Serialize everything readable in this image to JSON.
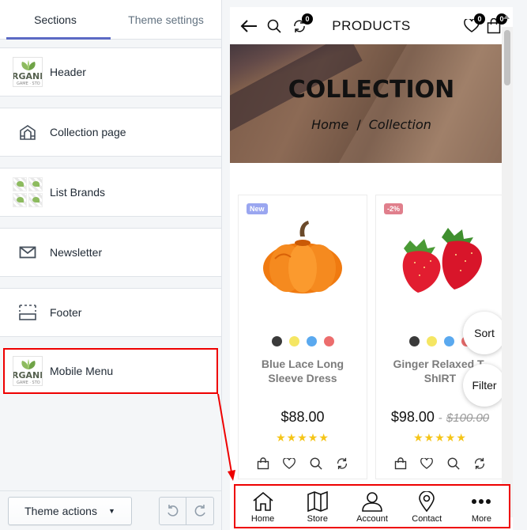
{
  "editor": {
    "tabs": [
      {
        "label": "Sections",
        "active": true
      },
      {
        "label": "Theme settings",
        "active": false
      }
    ],
    "sections": [
      {
        "label": "Header",
        "icon": "logo-thumbnail-icon"
      },
      {
        "label": "Collection page",
        "icon": "collection-page-icon"
      },
      {
        "label": "List Brands",
        "icon": "brand-grid-icon"
      },
      {
        "label": "Newsletter",
        "icon": "envelope-icon"
      },
      {
        "label": "Footer",
        "icon": "footer-layout-icon"
      },
      {
        "label": "Mobile Menu",
        "icon": "logo-thumbnail-icon",
        "highlighted": true
      }
    ],
    "logo_text": "RGANI",
    "logo_sub": "GAME · STO",
    "theme_actions_label": "Theme actions"
  },
  "preview": {
    "header": {
      "title": "PRODUCTS",
      "compare_count": "0",
      "wishlist_count": "0",
      "cart_count": "0"
    },
    "banner": {
      "title": "COLLECTION",
      "crumb_home": "Home",
      "crumb_sep": "/",
      "crumb_current": "Collection"
    },
    "products": [
      {
        "tag": "New",
        "tag_color": "#9aa6f0",
        "name": "Blue Lace Long Sleeve Dress",
        "price": "$88.00",
        "old_price": "",
        "rating": 5,
        "swatches": [
          "#3a3a3a",
          "#f5e663",
          "#5aa9ef",
          "#ec6d6d"
        ]
      },
      {
        "tag": "-2%",
        "tag_color": "#e07f8c",
        "name": "Ginger Relaxed T-ShIRT",
        "price": "$98.00",
        "old_price": "$100.00",
        "price_sep": "-",
        "rating": 5,
        "swatches": [
          "#3a3a3a",
          "#f5e663",
          "#5aa9ef",
          "#ec6d6d"
        ]
      }
    ],
    "stars_text": "★★★★★",
    "sort_label": "Sort",
    "filter_label": "Filter",
    "mobile_nav": [
      {
        "label": "Home",
        "icon": "home-icon"
      },
      {
        "label": "Store",
        "icon": "map-icon"
      },
      {
        "label": "Account",
        "icon": "user-icon"
      },
      {
        "label": "Contact",
        "icon": "location-pin-icon"
      },
      {
        "label": "More",
        "icon": "more-dots-icon"
      }
    ]
  },
  "colors": {
    "highlight": "#ee0000",
    "tab_accent": "#5c6ac4",
    "star": "#f5c518"
  }
}
